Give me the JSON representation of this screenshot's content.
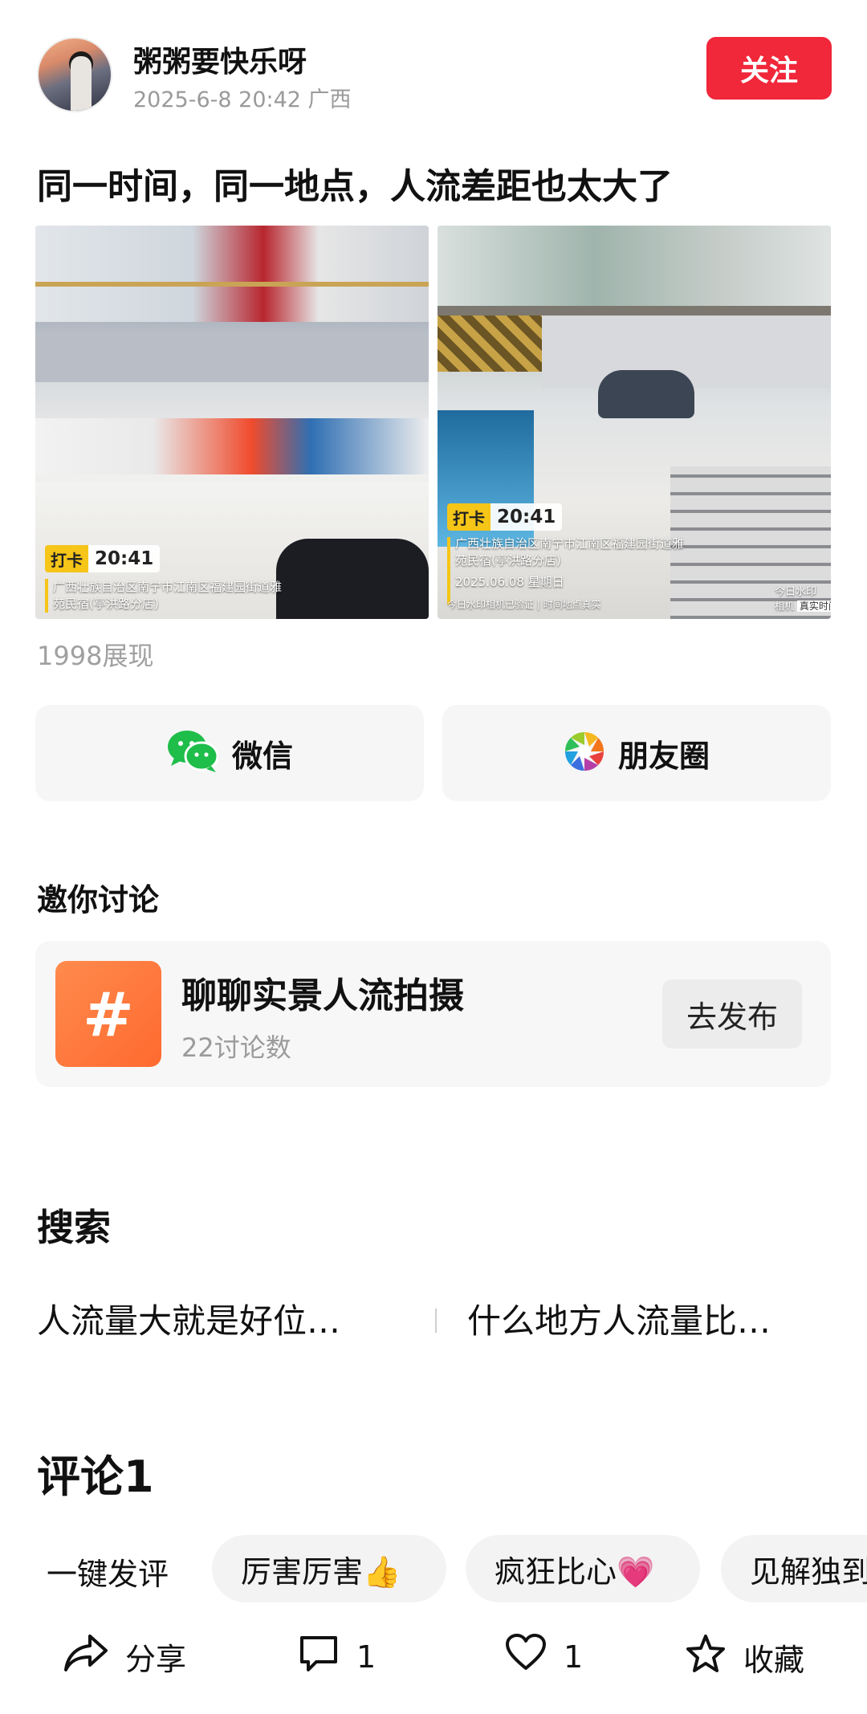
{
  "post": {
    "username": "粥粥要快乐呀",
    "datetime": "2025-6-8 20:42",
    "location": "广西",
    "follow_label": "关注",
    "title": "同一时间，同一地点，人流差距也太大了",
    "views": "1998展现"
  },
  "photos": {
    "left": {
      "stamp_tag": "打卡",
      "stamp_time": "20:41",
      "address_line1": "广西壮族自治区南宁市江南区福建园街道雅",
      "address_line2": "苑民宿(亭洪路分店)"
    },
    "right": {
      "stamp_tag": "打卡",
      "stamp_time": "20:41",
      "address_line1": "广西壮族自治区南宁市江南区福建园街道雅",
      "address_line2": "苑民宿(亭洪路分店)",
      "date_line": "2025.06.08 星期日",
      "verify_line": "今日水印相机已验证 | 时间地点真实",
      "watermark_brand": "今日水印",
      "watermark_sub": "相机",
      "watermark_tag": "真实时间"
    }
  },
  "share": {
    "wechat_label": "微信",
    "moments_label": "朋友圈",
    "wechat_icon": "wechat-icon",
    "moments_icon": "moments-icon"
  },
  "invite": {
    "heading": "邀你讨论",
    "topic_title": "聊聊实景人流拍摄",
    "topic_count": "22讨论数",
    "publish_label": "去发布",
    "icon": "hashtag-icon",
    "icon_glyph": "#"
  },
  "search": {
    "heading": "搜索",
    "items": [
      "人流量大就是好位…",
      "什么地方人流量比…"
    ]
  },
  "comments": {
    "heading": "评论1",
    "quick_label": "一键发评",
    "quick_replies": [
      "厉害厉害👍",
      "疯狂比心💗",
      "见解独到"
    ]
  },
  "actions": {
    "share_label": "分享",
    "comment_count": "1",
    "like_count": "1",
    "favorite_label": "收藏"
  },
  "colors": {
    "follow_button": "#f1273a",
    "topic_icon": "#ff7a3d",
    "stamp_yellow": "#f5c518"
  }
}
